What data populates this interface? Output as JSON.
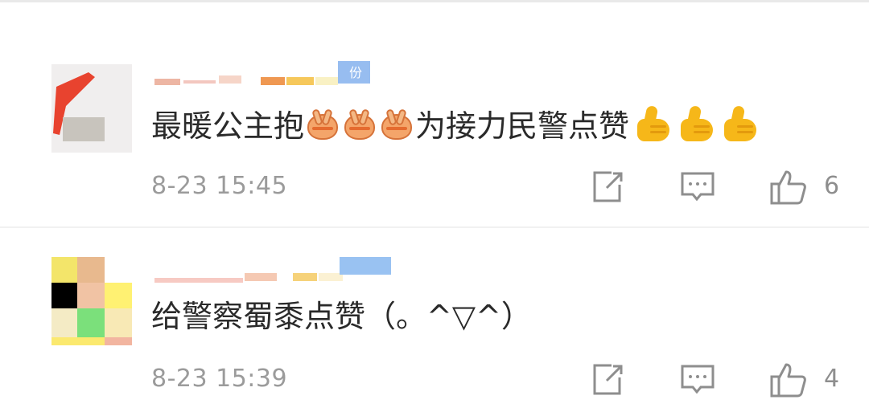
{
  "comments": [
    {
      "text_before": "最暖公主抱",
      "text_after": "为接力民警点赞",
      "emoji_sequence_1": [
        "clap-icon",
        "clap-icon",
        "clap-icon"
      ],
      "emoji_sequence_2": [
        "thumbs-up-icon",
        "thumbs-up-icon",
        "thumbs-up-icon"
      ],
      "timestamp": "8-23 15:45",
      "likes": "6",
      "badge": "份"
    },
    {
      "text": "给警察蜀黍点赞（。^▽^）",
      "timestamp": "8-23 15:39",
      "likes": "4"
    }
  ],
  "icons": [
    "repost-icon",
    "comment-icon",
    "like-icon"
  ],
  "colors": {
    "text": "#2a2a2a",
    "meta": "#9b9b9b",
    "icon": "#8e8e8e"
  }
}
